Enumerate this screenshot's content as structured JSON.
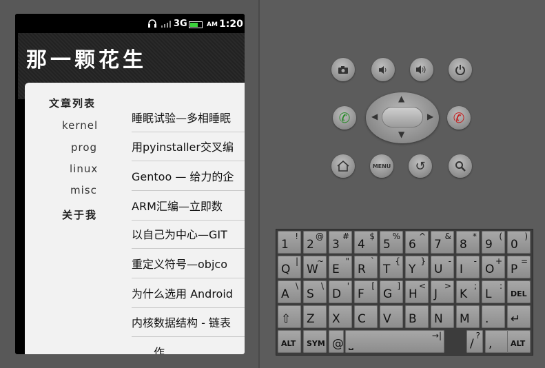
{
  "status_bar": {
    "network": "3G",
    "ampm": "AM",
    "time": "1:20"
  },
  "app": {
    "title": "那一颗花生"
  },
  "sidebar": {
    "articles_label": "文章列表",
    "items": [
      "kernel",
      "prog",
      "linux",
      "misc"
    ],
    "about_label": "关于我"
  },
  "articles": [
    "睡眠试验—多相睡眠",
    "用pyinstaller交叉编",
    "Gentoo — 给力的企",
    "ARM汇编—立即数",
    "以自己为中心—GIT",
    "重定义符号—objco",
    "为什么选用 Android",
    "内核数据结构 - 链表",
    "……作……"
  ],
  "buttons": {
    "menu": "MENU"
  },
  "keyboard": {
    "row1": [
      [
        "1",
        "!"
      ],
      [
        "2",
        "@"
      ],
      [
        "3",
        "#"
      ],
      [
        "4",
        "$"
      ],
      [
        "5",
        "%"
      ],
      [
        "6",
        "^"
      ],
      [
        "7",
        "&"
      ],
      [
        "8",
        "*"
      ],
      [
        "9",
        "("
      ],
      [
        "0",
        ")"
      ]
    ],
    "row2": [
      [
        "Q",
        "|"
      ],
      [
        "W",
        "~"
      ],
      [
        "E",
        "\""
      ],
      [
        "R",
        "`"
      ],
      [
        "T",
        "{"
      ],
      [
        "Y",
        "}"
      ],
      [
        "U",
        "-"
      ],
      [
        "I",
        "-"
      ],
      [
        "O",
        "+"
      ],
      [
        "P",
        "="
      ]
    ],
    "row3": [
      [
        "A",
        "\\"
      ],
      [
        "S",
        "\\"
      ],
      [
        "D",
        "'"
      ],
      [
        "F",
        "["
      ],
      [
        "G",
        "]"
      ],
      [
        "H",
        "<"
      ],
      [
        "J",
        ">"
      ],
      [
        "K",
        ";"
      ],
      [
        "L",
        ":"
      ],
      [
        "DEL",
        ""
      ]
    ],
    "row4": [
      "Z",
      "X",
      "C",
      "V",
      "B",
      "N",
      "M",
      "."
    ],
    "row5": {
      "alt_left": "ALT",
      "sym": "SYM",
      "at": "@",
      "slash": "/",
      "question": "?",
      "comma": ",",
      "alt_right": "ALT"
    }
  }
}
